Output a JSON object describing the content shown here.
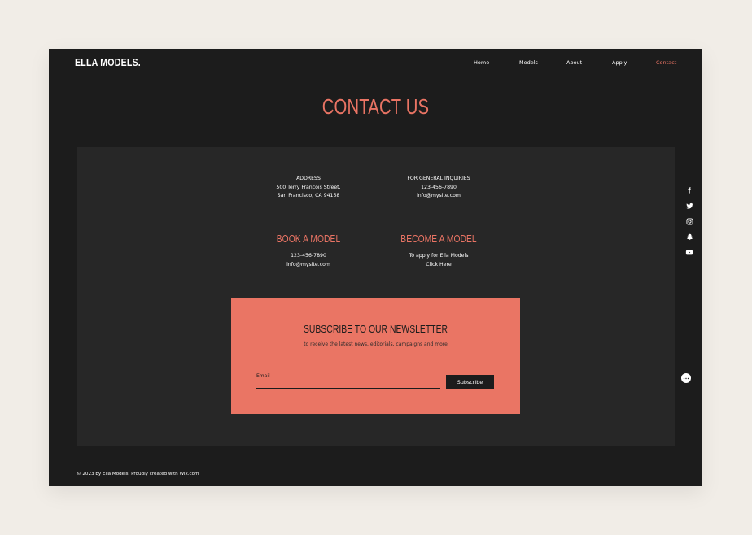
{
  "header": {
    "brand": "ELLA MODELS.",
    "nav": [
      {
        "label": "Home"
      },
      {
        "label": "Models"
      },
      {
        "label": "About"
      },
      {
        "label": "Apply"
      },
      {
        "label": "Contact",
        "active": true
      }
    ]
  },
  "page_title": "CONTACT US",
  "address": {
    "heading": "ADDRESS",
    "line1": "500 Terry Francois Street,",
    "line2": "San Francisco, CA 94158"
  },
  "inquiries": {
    "heading": "FOR GENERAL INQUIRIES",
    "phone": "123-456-7890",
    "email": "info@mysite.com"
  },
  "book": {
    "heading": "BOOK A MODEL",
    "phone": "123-456-7890",
    "email": "info@mysite.com"
  },
  "become": {
    "heading": "BECOME A MODEL",
    "text": "To apply for Ella Models",
    "link": "Click Here"
  },
  "newsletter": {
    "title": "SUBSCRIBE TO OUR NEWSLETTER",
    "subtitle": "to receive the latest news, editorials, campaigns and more",
    "email_label": "Email",
    "button": "Subscribe"
  },
  "footer": {
    "text": "© 2023 by Ella Models. Proudly created with Wix.com"
  },
  "social": [
    "facebook-icon",
    "twitter-icon",
    "instagram-icon",
    "snapchat-icon",
    "youtube-icon"
  ],
  "colors": {
    "accent": "#ea7464",
    "background": "#1c1c1c",
    "panel": "#272727",
    "page_bg": "#f1ede7"
  }
}
